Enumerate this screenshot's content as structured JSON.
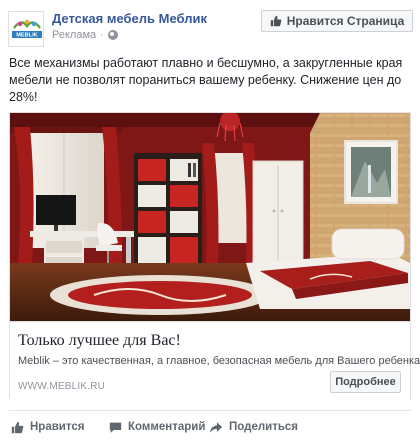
{
  "page": {
    "name": "Детская мебель Меблик",
    "sponsored_label": "Реклама",
    "separator": "·",
    "logo_text": "MEBLIK",
    "like_page_label": "Нравится Страница"
  },
  "post": {
    "text": "Все механизмы работают плавно и бесшумно, а закругленные края мебели не позволят пораниться вашему ребенку. Снижение цен до 28%!"
  },
  "card": {
    "title": "Только лучшее для Вас!",
    "description": "Meblik – это качественная, а главное, безопасная мебель для Вашего ребенка!",
    "domain": "WWW.MEBLIK.RU",
    "cta_label": "Подробнее"
  },
  "actions": {
    "like_label": "Нравится",
    "comment_label": "Комментарий",
    "share_label": "Поделиться"
  },
  "colors": {
    "link_blue": "#365899",
    "wall_red": "#8e1b1a",
    "floor_brown": "#5a2a14",
    "muted_text": "#90949c"
  },
  "icons": [
    "globe-icon",
    "thumbs-up-icon",
    "comment-icon",
    "share-icon"
  ]
}
